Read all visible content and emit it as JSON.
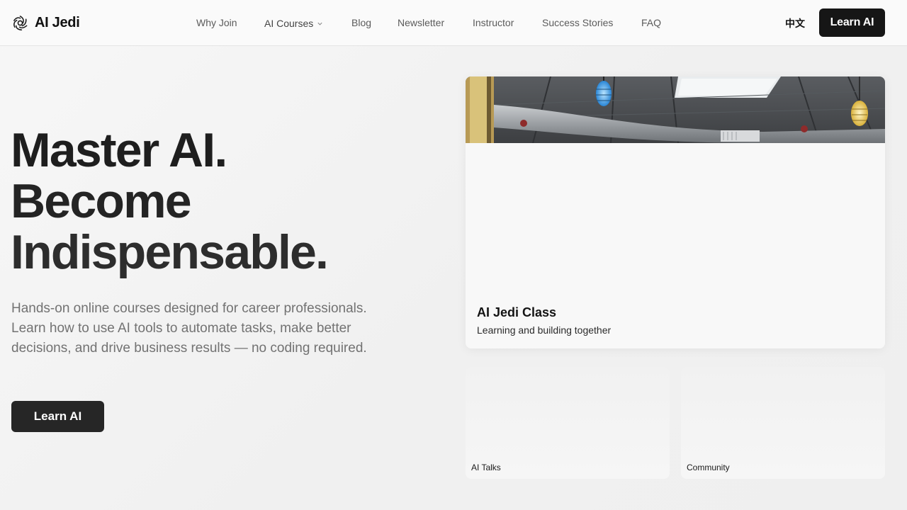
{
  "header": {
    "brand": "AI Jedi",
    "nav": [
      {
        "label": "Why Join"
      },
      {
        "label": "AI Courses",
        "has_dropdown": true
      },
      {
        "label": "Blog"
      },
      {
        "label": "Newsletter"
      },
      {
        "label": "Instructor"
      },
      {
        "label": "Success Stories"
      },
      {
        "label": "FAQ"
      }
    ],
    "language_toggle": "中文",
    "cta_label": "Learn AI"
  },
  "hero": {
    "title_lines": [
      "Master AI.",
      "Become",
      "Indispensable."
    ],
    "subtitle": "Hands-on online courses designed for career professionals. Learn how to use AI tools to automate tasks, make better decisions, and drive business results — no coding required.",
    "cta_label": "Learn AI"
  },
  "cards": {
    "main": {
      "title": "AI Jedi Class",
      "description": "Learning and building together"
    },
    "small": [
      {
        "label": "AI Talks"
      },
      {
        "label": "Community"
      }
    ]
  },
  "icons": {
    "logo": "ai-jedi-logo-icon",
    "dropdown": "chevron-down-icon"
  },
  "colors": {
    "primary_button": "#161616",
    "hero_button": "#262626",
    "text_dark": "#1c1c1c",
    "text_muted": "#727272",
    "background": "#f3f3f3"
  }
}
